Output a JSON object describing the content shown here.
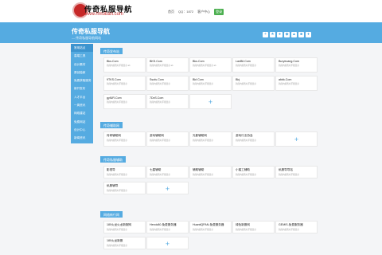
{
  "header": {
    "logo_text": "传奇私服导航",
    "logo_url": "www.hmoban.com",
    "nav": [
      "首页",
      "QQ：1872",
      "客户中心"
    ],
    "nav_btn": "登录"
  },
  "banner": {
    "title": "传奇私服导航",
    "subtitle": "— 传奇私服导航网站"
  },
  "sidebar": [
    "常用站点",
    "高端工具",
    "设计素材",
    "原创独家",
    "免费获取服务",
    "新开发布",
    "人才平台",
    "一周资讯",
    "网络建站",
    "免费网站",
    "设计中心",
    "新闻资讯"
  ],
  "sections": [
    {
      "title": "传奇发布站",
      "items": [
        {
          "t": "Bks.Com",
          "d": "新闻内容暂时不能显示 ab"
        },
        {
          "t": "BKS.Com",
          "d": "新闻内容暂时不能显示 ab"
        },
        {
          "t": "Bks.Com",
          "d": "新闻内容暂时不能显示 ab"
        },
        {
          "t": "LanBit.Com",
          "d": "新闻内容暂时不能显示"
        },
        {
          "t": "Buryeuang.Com",
          "d": "新闻内容暂时不能显示"
        },
        {
          "t": "9TKS.Com",
          "d": "新闻内容暂时不能显示"
        },
        {
          "t": "Ssofu.Com",
          "d": "新闻内容暂时不能显示"
        },
        {
          "t": "Bkf.Com",
          "d": "新闻内容暂时不能显示"
        },
        {
          "t": "Bbj",
          "d": "新闻内容暂时不能显示"
        },
        {
          "t": "abbk.Com",
          "d": "新闻内容暂时不能显示"
        },
        {
          "t": "gyfUR.Com",
          "d": "新闻内容暂时不能显示"
        },
        {
          "t": "7DxS.Com",
          "d": "新闻内容暂时不能显示"
        }
      ]
    },
    {
      "title": "传奇辅助网",
      "items": [
        {
          "t": "传奇辅助网",
          "d": "新闻内容暂时不能显示"
        },
        {
          "t": "游戏辅助网",
          "d": "新闻内容暂时不能显示"
        },
        {
          "t": "光影辅助网",
          "d": "新闻内容暂时不能显示"
        },
        {
          "t": "游戏行业协会",
          "d": "新闻内容暂时不能显示"
        }
      ]
    },
    {
      "title": "传奇私服辅助",
      "items": [
        {
          "t": "影视导",
          "d": "新闻内容暂时不能显示"
        },
        {
          "t": "七星辅助",
          "d": "新闻内容暂时不能显示"
        },
        {
          "t": "辅助辅助",
          "d": "新闻内容暂时不能显示"
        },
        {
          "t": "小蜜工辅助",
          "d": "新闻内容暂时不能显示"
        },
        {
          "t": "私服导导站",
          "d": "新闻内容暂时不能显示"
        },
        {
          "t": "私服辅导",
          "d": "新闻内容暂时不能显示"
        }
      ]
    },
    {
      "title": "网络新行网",
      "items": [
        {
          "t": "180火龙火龙新服网",
          "d": "新闻内容暂时不能显示"
        },
        {
          "t": "Heroic80-免费服务器",
          "d": "新闻内容暂时不能显示"
        },
        {
          "t": "HuantiQPAN-免费服务器",
          "d": "新闻内容暂时不能显示"
        },
        {
          "t": "绿色新服网",
          "d": "新闻内容暂时不能显示"
        },
        {
          "t": "GEMIS-免费服务器",
          "d": "新闻内容暂时不能显示"
        },
        {
          "t": "180火龙新服",
          "d": "新闻内容暂时不能显示"
        }
      ]
    }
  ]
}
